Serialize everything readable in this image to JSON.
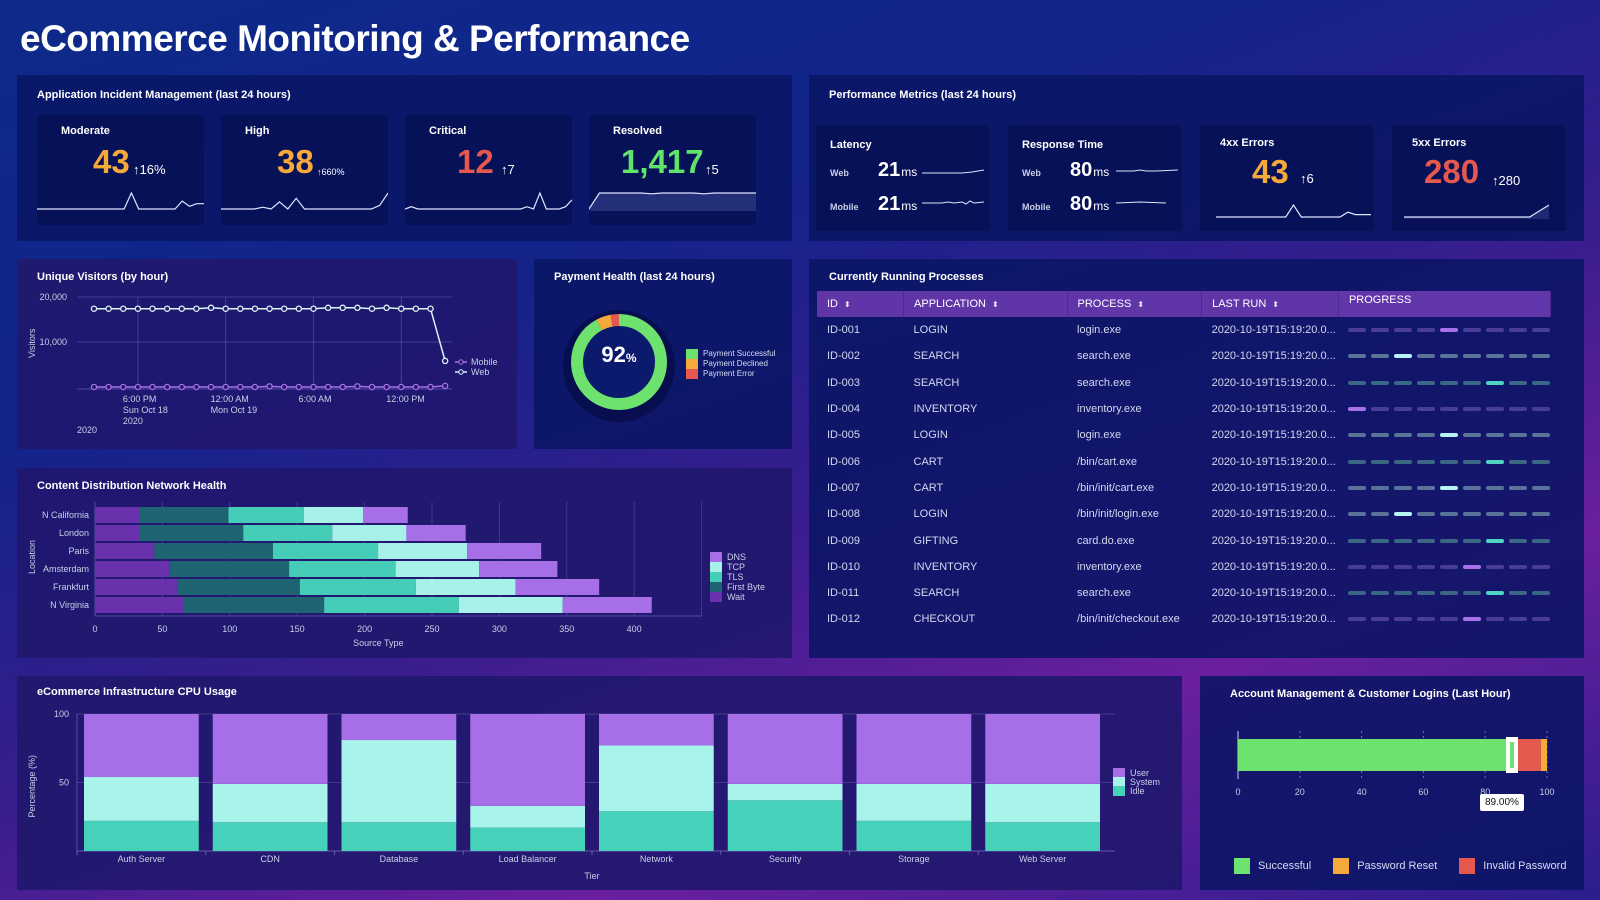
{
  "header": {
    "title": "eCommerce Monitoring & Performance"
  },
  "incidents": {
    "title": "Application Incident Management (last 24 hours)",
    "cards": [
      {
        "label": "Moderate",
        "value": "43",
        "delta": "↑16%",
        "color": "#f5a93a",
        "spark": [
          0,
          0,
          0,
          0,
          0,
          0,
          0,
          0,
          0,
          0,
          0,
          0,
          0,
          6,
          0,
          0,
          0,
          0,
          0,
          0,
          3,
          1,
          2,
          2
        ]
      },
      {
        "label": "High",
        "value": "38",
        "delta": "↑660%",
        "color": "#f5a93a",
        "spark": [
          0,
          0,
          0,
          0,
          0,
          1,
          0,
          4,
          0,
          6,
          0,
          0,
          0,
          0,
          0,
          0,
          0,
          0,
          0,
          2,
          9
        ]
      },
      {
        "label": "Critical",
        "value": "12",
        "delta": "↑7",
        "color": "#e4584d",
        "spark": [
          0,
          1,
          0,
          0,
          0,
          0,
          0,
          0,
          0,
          0,
          0,
          0,
          0,
          0,
          0,
          0,
          0,
          0,
          0,
          1,
          0,
          7,
          0,
          0,
          0,
          1,
          4
        ]
      },
      {
        "label": "Resolved",
        "value": "1,417",
        "delta": "↑5",
        "color": "#5fe36b",
        "spark": [
          0,
          4,
          4,
          4,
          4,
          4,
          3.8,
          4,
          4,
          4,
          4,
          3.8,
          4,
          4,
          4,
          4,
          4
        ]
      }
    ]
  },
  "performance": {
    "title": "Performance Metrics (last 24 hours)",
    "latency": {
      "label": "Latency",
      "rows": [
        {
          "label": "Web",
          "value": "21",
          "unit": "ms"
        },
        {
          "label": "Mobile",
          "value": "21",
          "unit": "ms"
        }
      ]
    },
    "response": {
      "label": "Response Time",
      "rows": [
        {
          "label": "Web",
          "value": "80",
          "unit": "ms"
        },
        {
          "label": "Mobile",
          "value": "80",
          "unit": "ms"
        }
      ]
    },
    "errors4xx": {
      "label": "4xx Errors",
      "value": "43",
      "delta": "↑6",
      "spark": [
        0,
        0,
        0,
        0,
        0,
        0,
        0,
        0,
        0,
        0,
        5,
        0,
        0,
        0,
        0,
        0,
        0,
        2,
        1,
        1,
        1
      ]
    },
    "errors5xx": {
      "label": "5xx Errors",
      "value": "280",
      "delta": "↑280",
      "spark": [
        0,
        0,
        0,
        0,
        0,
        0,
        0,
        0,
        0,
        0,
        0,
        0,
        0,
        0,
        2,
        4
      ]
    }
  },
  "visitors": {
    "title": "Unique Visitors (by hour)",
    "chart_data": {
      "type": "line",
      "title": "Unique Visitors (by hour)",
      "xlabel": "",
      "ylabel": "Visitors",
      "ylim": [
        0,
        20000
      ],
      "yticks": [
        "20,000",
        "10,000"
      ],
      "xticks": [
        {
          "index": 3,
          "lines": [
            "6:00 PM",
            "Sun Oct 18",
            "2020"
          ]
        },
        {
          "index": 9,
          "lines": [
            "12:00 AM",
            "Mon Oct 19"
          ]
        },
        {
          "index": 15,
          "lines": [
            "6:00 AM"
          ]
        },
        {
          "index": 21,
          "lines": [
            "12:00 PM"
          ]
        }
      ],
      "year_label": "2020",
      "series": [
        {
          "name": "Mobile",
          "color": "#a970e8",
          "values": [
            0,
            0,
            0,
            0,
            0,
            0,
            0,
            0,
            0,
            0,
            0,
            0,
            150,
            0,
            0,
            0,
            0,
            0,
            150,
            0,
            0,
            0,
            0,
            0,
            250
          ]
        },
        {
          "name": "Web",
          "color": "#d9f5f5",
          "values": [
            17400,
            17400,
            17400,
            17400,
            17400,
            17400,
            17400,
            17400,
            17600,
            17400,
            17400,
            17400,
            17400,
            17400,
            17400,
            17400,
            17600,
            17600,
            17600,
            17400,
            17600,
            17400,
            17400,
            17400,
            5800
          ]
        }
      ]
    }
  },
  "payment": {
    "title": "Payment Health (last 24 hours)",
    "center_value": "92",
    "center_unit": "%",
    "chart_data": {
      "type": "pie",
      "labels": [
        "Payment Successful",
        "Payment Declined",
        "Payment Error"
      ],
      "values": [
        92,
        5,
        3
      ],
      "colors": [
        "#6de26f",
        "#f5a93a",
        "#e4584d"
      ]
    }
  },
  "cdn": {
    "title": "Content Distribution Network Health",
    "chart_data": {
      "type": "bar",
      "orientation": "horizontal",
      "stacked": true,
      "xlabel": "Source Type",
      "ylabel": "Location",
      "xlim": [
        0,
        450
      ],
      "xticks": [
        0,
        50,
        100,
        150,
        200,
        250,
        300,
        350,
        400
      ],
      "categories": [
        "N California",
        "London",
        "Paris",
        "Amsterdam",
        "Frankfurt",
        "N Virginia"
      ],
      "series": [
        {
          "name": "Wait",
          "color": "#6a31ad",
          "values": [
            33,
            33,
            44,
            55,
            61,
            66
          ]
        },
        {
          "name": "First Byte",
          "color": "#1f6472",
          "values": [
            66,
            77,
            88,
            89,
            91,
            104
          ]
        },
        {
          "name": "TLS",
          "color": "#46cdb8",
          "values": [
            56,
            66,
            78,
            79,
            86,
            100
          ]
        },
        {
          "name": "TCP",
          "color": "#a8f1e8",
          "values": [
            44,
            55,
            66,
            62,
            74,
            77
          ]
        },
        {
          "name": "DNS",
          "color": "#a66fe8",
          "values": [
            33,
            44,
            55,
            58,
            62,
            66
          ]
        }
      ],
      "legend": [
        "DNS",
        "TCP",
        "TLS",
        "First Byte",
        "Wait"
      ]
    }
  },
  "processes": {
    "title": "Currently Running Processes",
    "columns": [
      {
        "label": "ID",
        "sortable": true
      },
      {
        "label": "APPLICATION",
        "sortable": true
      },
      {
        "label": "PROCESS",
        "sortable": true
      },
      {
        "label": "LAST RUN",
        "sortable": true
      },
      {
        "label": "PROGRESS",
        "sortable": false
      }
    ],
    "rows": [
      {
        "id": "ID-001",
        "app": "LOGIN",
        "process": "login.exe",
        "last_run": "2020-10-19T15:19:20.0...",
        "progress_step": 5,
        "color": "purple"
      },
      {
        "id": "ID-002",
        "app": "SEARCH",
        "process": "search.exe",
        "last_run": "2020-10-19T15:19:20.0...",
        "progress_step": 3,
        "color": "light"
      },
      {
        "id": "ID-003",
        "app": "SEARCH",
        "process": "search.exe",
        "last_run": "2020-10-19T15:19:20.0...",
        "progress_step": 7,
        "color": "teal"
      },
      {
        "id": "ID-004",
        "app": "INVENTORY",
        "process": "inventory.exe",
        "last_run": "2020-10-19T15:19:20.0...",
        "progress_step": 1,
        "color": "purple"
      },
      {
        "id": "ID-005",
        "app": "LOGIN",
        "process": "login.exe",
        "last_run": "2020-10-19T15:19:20.0...",
        "progress_step": 5,
        "color": "light"
      },
      {
        "id": "ID-006",
        "app": "CART",
        "process": "/bin/cart.exe",
        "last_run": "2020-10-19T15:19:20.0...",
        "progress_step": 7,
        "color": "teal"
      },
      {
        "id": "ID-007",
        "app": "CART",
        "process": "/bin/init/cart.exe",
        "last_run": "2020-10-19T15:19:20.0...",
        "progress_step": 5,
        "color": "light"
      },
      {
        "id": "ID-008",
        "app": "LOGIN",
        "process": "/bin/init/login.exe",
        "last_run": "2020-10-19T15:19:20.0...",
        "progress_step": 3,
        "color": "light"
      },
      {
        "id": "ID-009",
        "app": "GIFTING",
        "process": "card.do.exe",
        "last_run": "2020-10-19T15:19:20.0...",
        "progress_step": 7,
        "color": "teal"
      },
      {
        "id": "ID-010",
        "app": "INVENTORY",
        "process": "inventory.exe",
        "last_run": "2020-10-19T15:19:20.0...",
        "progress_step": 6,
        "color": "purple"
      },
      {
        "id": "ID-011",
        "app": "SEARCH",
        "process": "search.exe",
        "last_run": "2020-10-19T15:19:20.0...",
        "progress_step": 7,
        "color": "teal"
      },
      {
        "id": "ID-012",
        "app": "CHECKOUT",
        "process": "/bin/init/checkout.exe",
        "last_run": "2020-10-19T15:19:20.0...",
        "progress_step": 6,
        "color": "purple"
      }
    ],
    "progress_segments": 9,
    "palette": {
      "purple": {
        "on": "#a872ea",
        "off": "#4a3d9a"
      },
      "light": {
        "on": "#b7f3f3",
        "off": "#5a7398"
      },
      "teal": {
        "on": "#4fd3c3",
        "off": "#3a6884"
      }
    }
  },
  "cpu": {
    "title": "eCommerce Infrastructure CPU Usage",
    "chart_data": {
      "type": "bar",
      "stacked": true,
      "xlabel": "Tier",
      "ylabel": "Percentage (%)",
      "ylim": [
        0,
        100
      ],
      "yticks": [
        100,
        50
      ],
      "categories": [
        "Auth Server",
        "CDN",
        "Database",
        "Load Balancer",
        "Network",
        "Security",
        "Storage",
        "Web Server"
      ],
      "series": [
        {
          "name": "Idle",
          "color": "#46d1bb",
          "values": [
            22,
            21,
            21,
            17,
            29,
            37,
            22,
            21
          ]
        },
        {
          "name": "System",
          "color": "#a8f3ea",
          "values": [
            32,
            28,
            60,
            16,
            48,
            12,
            27,
            28
          ]
        },
        {
          "name": "User",
          "color": "#a66fe8",
          "values": [
            46,
            51,
            19,
            67,
            23,
            51,
            51,
            51
          ]
        }
      ],
      "legend": [
        "User",
        "System",
        "Idle"
      ]
    }
  },
  "logins": {
    "title": "Account Management & Customer Logins (Last Hour)",
    "tooltip": "89.00%",
    "chart_data": {
      "type": "bar",
      "orientation": "horizontal",
      "stacked": true,
      "xlim": [
        0,
        100
      ],
      "xticks": [
        0,
        20,
        40,
        60,
        80,
        100
      ],
      "series": [
        {
          "name": "Successful",
          "color": "#6de26f",
          "value": 89
        },
        {
          "name": "Invalid Password",
          "color": "#e4584d",
          "value": 9
        },
        {
          "name": "Password Reset",
          "color": "#f5a93a",
          "value": 2
        }
      ],
      "legend": [
        "Successful",
        "Password Reset",
        "Invalid Password"
      ]
    }
  }
}
